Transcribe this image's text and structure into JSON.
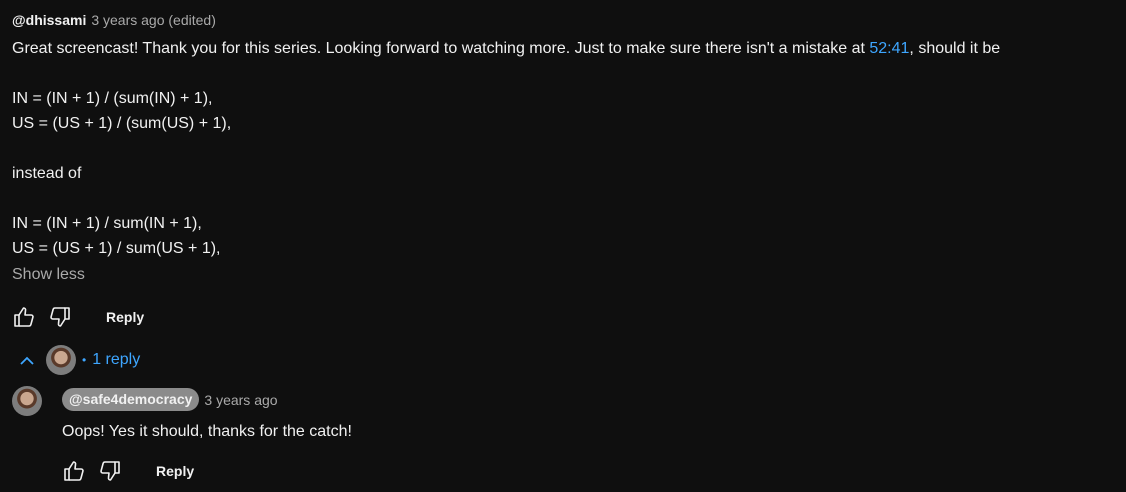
{
  "comment": {
    "author": "@dhissami",
    "time": "3 years ago (edited)",
    "line1_before": "Great screencast! Thank you for this series. Looking forward to watching more. Just to make sure there isn't a mistake at ",
    "timestamp_link": "52:41",
    "line1_after": ", should it be",
    "lines": [
      "",
      "IN = (IN + 1) / (sum(IN) + 1),",
      "US = (US + 1) / (sum(US) + 1),",
      "",
      "instead of",
      "",
      "IN = (IN + 1) / sum(IN + 1),",
      "US = (US + 1) / sum(US + 1),"
    ],
    "show_less": "Show less",
    "reply_label": "Reply"
  },
  "replies_toggle": {
    "label": "1 reply",
    "dot": "•"
  },
  "reply": {
    "author": "@safe4democracy",
    "time": "3 years ago",
    "text": "Oops! Yes it should, thanks for the catch!",
    "reply_label": "Reply"
  },
  "icons": {
    "like": "thumbs-up-icon",
    "dislike": "thumbs-down-icon",
    "collapse": "chevron-up-icon"
  },
  "colors": {
    "background": "#0f0f0f",
    "text": "#f1f1f1",
    "secondary": "#aaaaaa",
    "link": "#3ea6ff",
    "author_badge": "#8b8b8b"
  }
}
